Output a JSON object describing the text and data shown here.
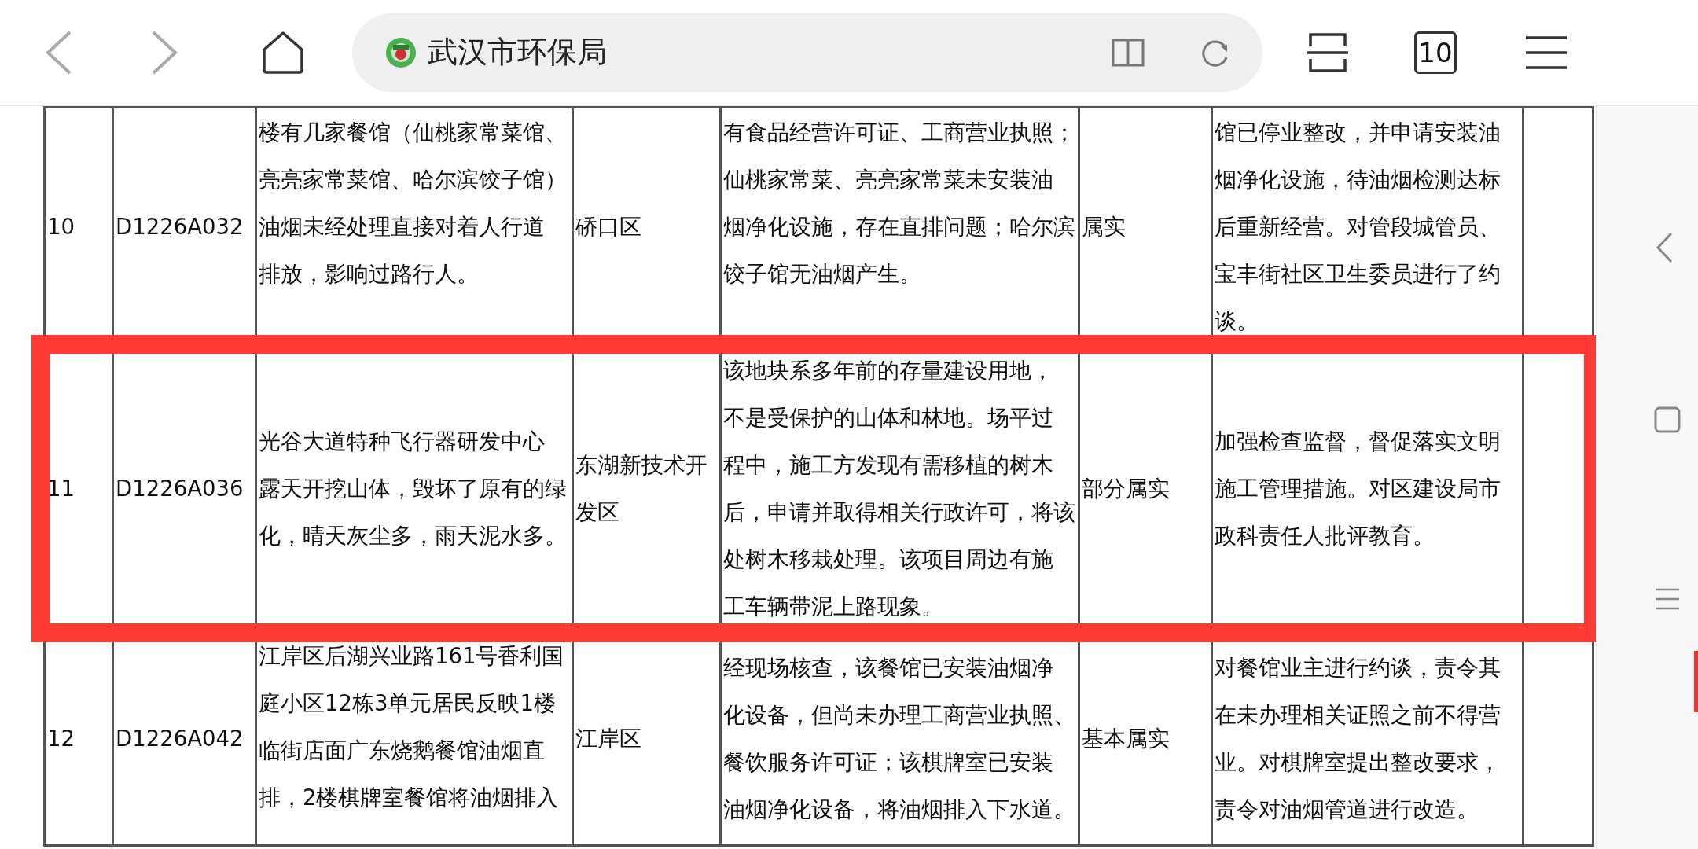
{
  "browser": {
    "address_title": "武汉市环保局",
    "tab_count": "10"
  },
  "table": {
    "rows": [
      {
        "highlighted": false,
        "cells": [
          {
            "lines": [
              "10"
            ]
          },
          {
            "lines": [
              "D1226A032"
            ]
          },
          {
            "lines": [
              "楼有几家餐馆（仙桃家常菜馆、",
              "亮亮家常菜馆、哈尔滨饺子馆）",
              "油烟未经处理直接对着人行道",
              "排放，影响过路行人。"
            ]
          },
          {
            "lines": [
              "硚口区"
            ]
          },
          {
            "lines": [
              "有食品经营许可证、工商营业执照；",
              "仙桃家常菜、亮亮家常菜未安装油",
              "烟净化设施，存在直排问题；哈尔滨",
              "饺子馆无油烟产生。"
            ]
          },
          {
            "lines": [
              "属实"
            ]
          },
          {
            "lines": [
              "馆已停业整改，并申请安装油",
              "烟净化设施，待油烟检测达标",
              "后重新经营。对管段城管员、",
              "宝丰街社区卫生委员进行了约",
              "谈。"
            ]
          }
        ]
      },
      {
        "highlighted": true,
        "cells": [
          {
            "lines": [
              "11"
            ]
          },
          {
            "lines": [
              "D1226A036"
            ]
          },
          {
            "lines": [
              "光谷大道特种飞行器研发中心",
              "露天开挖山体，毁坏了原有的绿",
              "化，晴天灰尘多，雨天泥水多。"
            ]
          },
          {
            "lines": [
              "东湖新技术开",
              "发区"
            ]
          },
          {
            "lines": [
              "该地块系多年前的存量建设用地，",
              "不是受保护的山体和林地。场平过",
              "程中，施工方发现有需移植的树木",
              "后，申请并取得相关行政许可，将该",
              "处树木移栽处理。该项目周边有施",
              "工车辆带泥上路现象。"
            ]
          },
          {
            "lines": [
              "部分属实"
            ]
          },
          {
            "lines": [
              "加强检查监督，督促落实文明",
              "施工管理措施。对区建设局市",
              "政科责任人批评教育。"
            ]
          }
        ]
      },
      {
        "highlighted": false,
        "cells": [
          {
            "lines": [
              "12"
            ]
          },
          {
            "lines": [
              "D1226A042"
            ]
          },
          {
            "lines": [
              "江岸区后湖兴业路161号香利国",
              "庭小区12栋3单元居民反映1楼",
              "临街店面广东烧鹅餐馆油烟直",
              "排，2楼棋牌室餐馆将油烟排入"
            ]
          },
          {
            "lines": [
              "江岸区"
            ]
          },
          {
            "lines": [
              "经现场核查，该餐馆已安装油烟净",
              "化设备，但尚未办理工商营业执照、",
              "餐饮服务许可证；该棋牌室已安装",
              "油烟净化设备，将油烟排入下水道。"
            ]
          },
          {
            "lines": [
              "基本属实"
            ]
          },
          {
            "lines": [
              "对餐馆业主进行约谈，责令其",
              "在未办理相关证照之前不得营",
              "业。对棋牌室提出整改要求，",
              "责令对油烟管道进行改造。"
            ]
          }
        ]
      }
    ]
  }
}
